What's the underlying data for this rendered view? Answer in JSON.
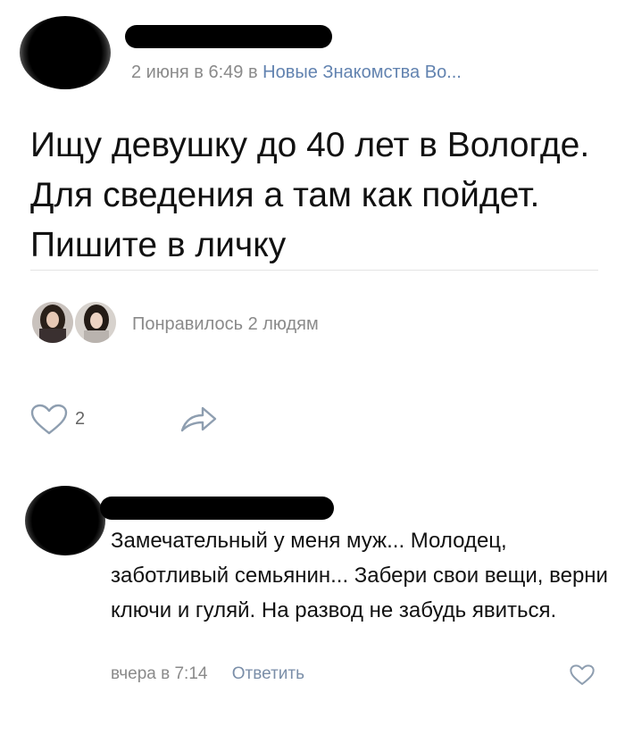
{
  "post": {
    "author_name": "",
    "date": "2 июня в 6:49",
    "in_word": "в",
    "group": "Новые Знакомства Во...",
    "text": "Ищу девушку до 40 лет в Вологде. Для сведения а там как пойдет. Пишите в личку",
    "likes_summary": "Понравилось 2 людям",
    "like_count": "2"
  },
  "comment": {
    "author_name": "",
    "text": "Замечательный у меня муж... Молодец, заботливый семьянин... Забери свои вещи, верни ключи и гуляй. На развод не забудь явиться.",
    "time": "вчера в 7:14",
    "reply_label": "Ответить"
  },
  "colors": {
    "link": "#6283b0",
    "meta": "#8a8a8a",
    "icon": "#8e9eb0"
  },
  "icons": [
    "heart-icon",
    "share-icon",
    "comment-like-heart-icon"
  ]
}
